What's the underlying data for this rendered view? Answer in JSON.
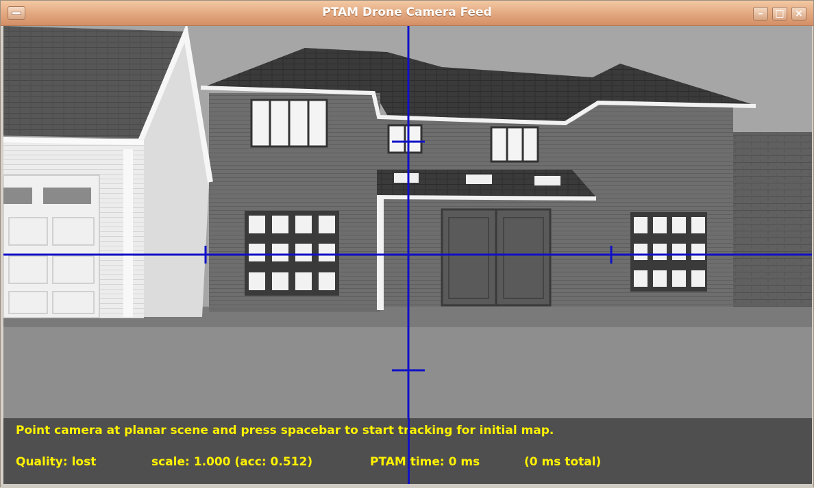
{
  "window": {
    "title": "PTAM Drone Camera Feed",
    "buttons": {
      "minimize": "–",
      "maximize": "□",
      "close": "×"
    }
  },
  "overlay": {
    "instruction": "Point camera at planar scene and press spacebar to start tracking for initial map.",
    "quality": "Quality: lost",
    "scale": "scale: 1.000 (acc: 0.512)",
    "ptam_time": "PTAM time: 0 ms",
    "total_time": "(0 ms total)"
  },
  "colors": {
    "crosshair": "#1010c8",
    "overlay_text": "#fff200",
    "titlebar": "#e2a77f"
  },
  "icons": [
    "window-menu-icon",
    "minimize-icon",
    "maximize-icon",
    "close-icon",
    "crosshair-icon"
  ]
}
